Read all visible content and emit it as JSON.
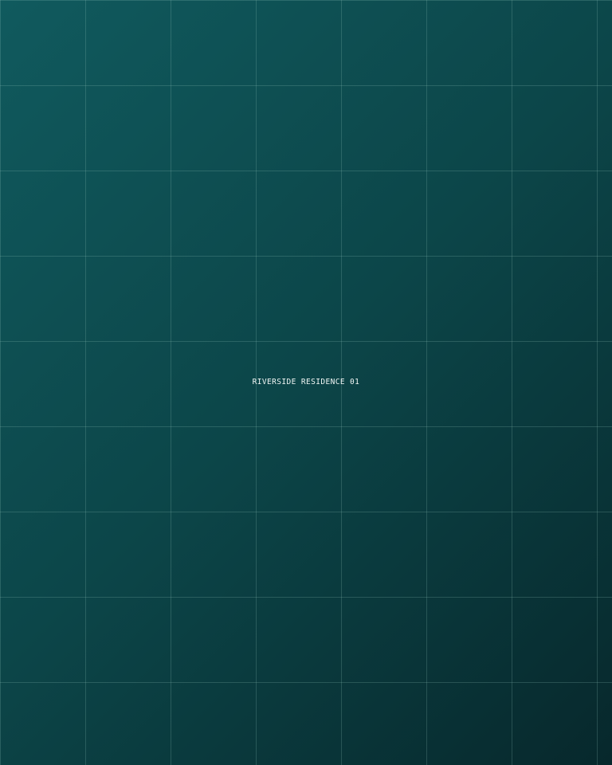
{
  "caption": {
    "text": "RIVERSIDE RESIDENCE 01"
  },
  "colors": {
    "background_top_left": "#105a5e",
    "background_bottom_right": "#07282c",
    "grid_line": "#6fa7a2",
    "caption_text": "#f1f6f5"
  }
}
